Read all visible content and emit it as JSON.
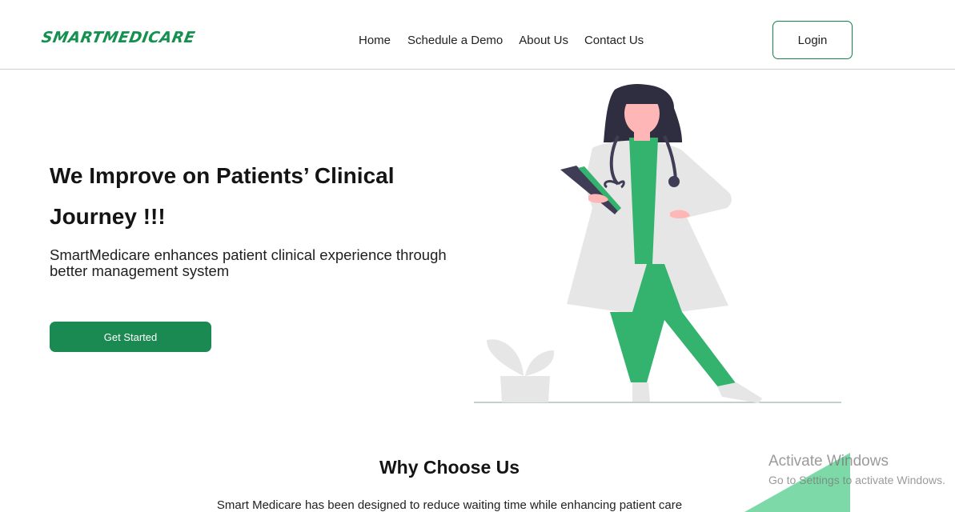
{
  "header": {
    "logo_text": "SMARTMEDICARE",
    "nav": {
      "home": "Home",
      "schedule_demo": "Schedule a Demo",
      "about": "About Us",
      "contact": "Contact Us"
    },
    "login_label": "Login"
  },
  "hero": {
    "title_line1": "We Improve on Patients’ Clinical",
    "title_line2": "Journey !!!",
    "subtitle": "SmartMedicare enhances patient clinical experience through better management system",
    "cta_label": "Get Started"
  },
  "why": {
    "title": "Why Choose Us",
    "description": "Smart Medicare has been designed to reduce waiting time while enhancing patient care"
  },
  "watermark": {
    "title": "Activate Windows",
    "subtitle": "Go to Settings to activate Windows."
  },
  "colors": {
    "brand_green": "#14904f",
    "button_green": "#1a8a52",
    "scrubs_green": "#34b36e",
    "accent_light_green": "#7dd9a8"
  },
  "icons": {
    "illustration": "doctor-with-clipboard-illustration",
    "plant": "potted-plant-illustration"
  }
}
